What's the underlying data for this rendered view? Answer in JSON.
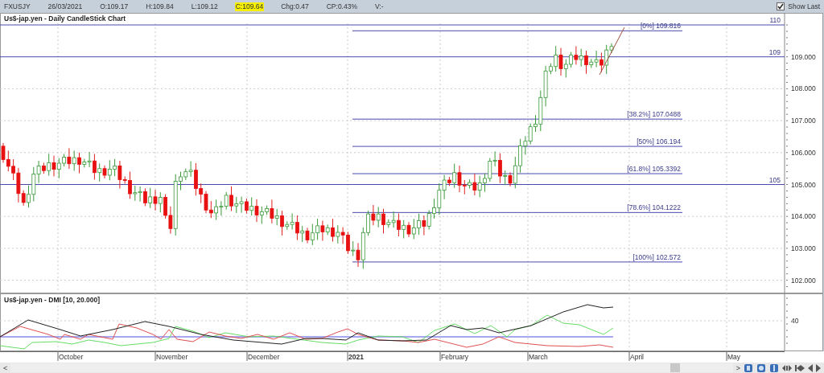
{
  "toolbar": {
    "symbol": "FXUSJY",
    "date": "26/03/2021",
    "open": "O:109.17",
    "high": "H:109.84",
    "low": "L:109.12",
    "close": {
      "text": "C:109.64",
      "highlighted": true
    },
    "change": "Chg:0.47",
    "change_percent": "CP:0.43%",
    "volume": "V:-",
    "show_last": {
      "label": "Show Last",
      "checked": true
    }
  },
  "price_panel": {
    "title": "Us$-jap.yen - Daily CandleStick Chart",
    "level_lines": [
      {
        "label": "110"
      },
      {
        "label": "109"
      },
      {
        "label": "105"
      }
    ],
    "fibonacci_levels": [
      {
        "label": "[0%] 109.816"
      },
      {
        "label": "[38.2%] 107.0488"
      },
      {
        "label": "[50%] 106.194"
      },
      {
        "label": "[61.8%] 105.3392"
      },
      {
        "label": "[78.6%] 104.1222"
      },
      {
        "label": "[100%] 102.572"
      }
    ],
    "y_axis": [
      "109.000",
      "108.000",
      "107.000",
      "106.000",
      "105.000",
      "104.000",
      "103.000",
      "102.000"
    ]
  },
  "dmi_panel": {
    "title": "Us$-jap.yen - DMI [10, 20.000]",
    "y_axis": [
      "40"
    ]
  },
  "time_axis": [
    {
      "label": "October",
      "kind": "month"
    },
    {
      "label": "November",
      "kind": "month"
    },
    {
      "label": "December",
      "kind": "month"
    },
    {
      "label": "2021",
      "kind": "year"
    },
    {
      "label": "February",
      "kind": "month"
    },
    {
      "label": "March",
      "kind": "month"
    },
    {
      "label": "April",
      "kind": "month"
    },
    {
      "label": "May",
      "kind": "month"
    }
  ],
  "scrollbar": {
    "left": "<",
    "right": ">"
  }
}
